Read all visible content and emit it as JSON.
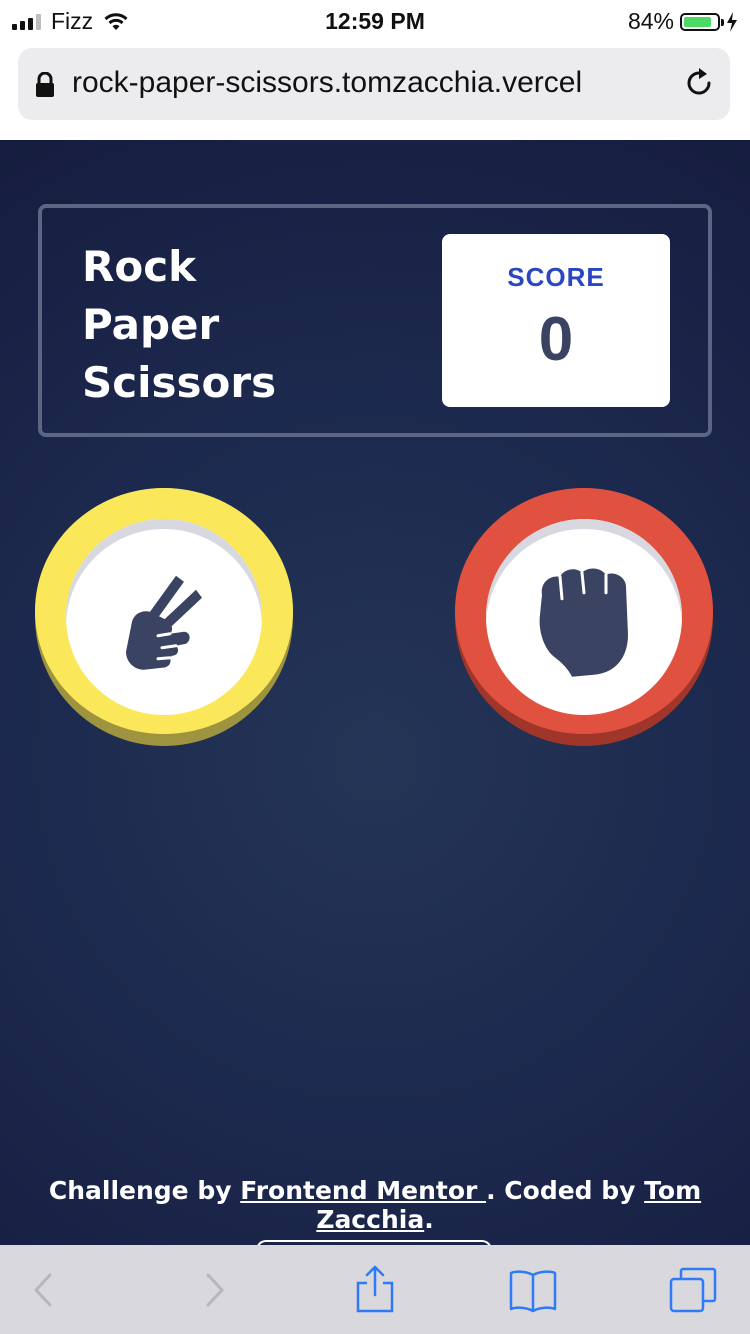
{
  "status_bar": {
    "carrier": "Fizz",
    "time": "12:59 PM",
    "battery_percent": "84%",
    "battery_level": 0.84
  },
  "browser": {
    "url": "rock-paper-scissors.tomzacchia.vercel"
  },
  "header": {
    "title_lines": [
      "Rock",
      "Paper",
      "Scissors"
    ],
    "score_label": "SCORE",
    "score_value": "0"
  },
  "tokens": [
    {
      "name": "scissors",
      "icon": "scissors-hand-icon",
      "color": "#fbe85a"
    },
    {
      "name": "rock",
      "icon": "rock-fist-icon",
      "color": "#e05140"
    }
  ],
  "footer": {
    "prefix": "Challenge by ",
    "link1": "Frontend Mentor ",
    "middle": ". Coded by ",
    "link2": "Tom Zacchia",
    "suffix": "."
  },
  "colors": {
    "background": "#1f2a4e",
    "score_label": "#2a46c0",
    "score_value": "#3b4363",
    "header_border": "#5c6583"
  }
}
